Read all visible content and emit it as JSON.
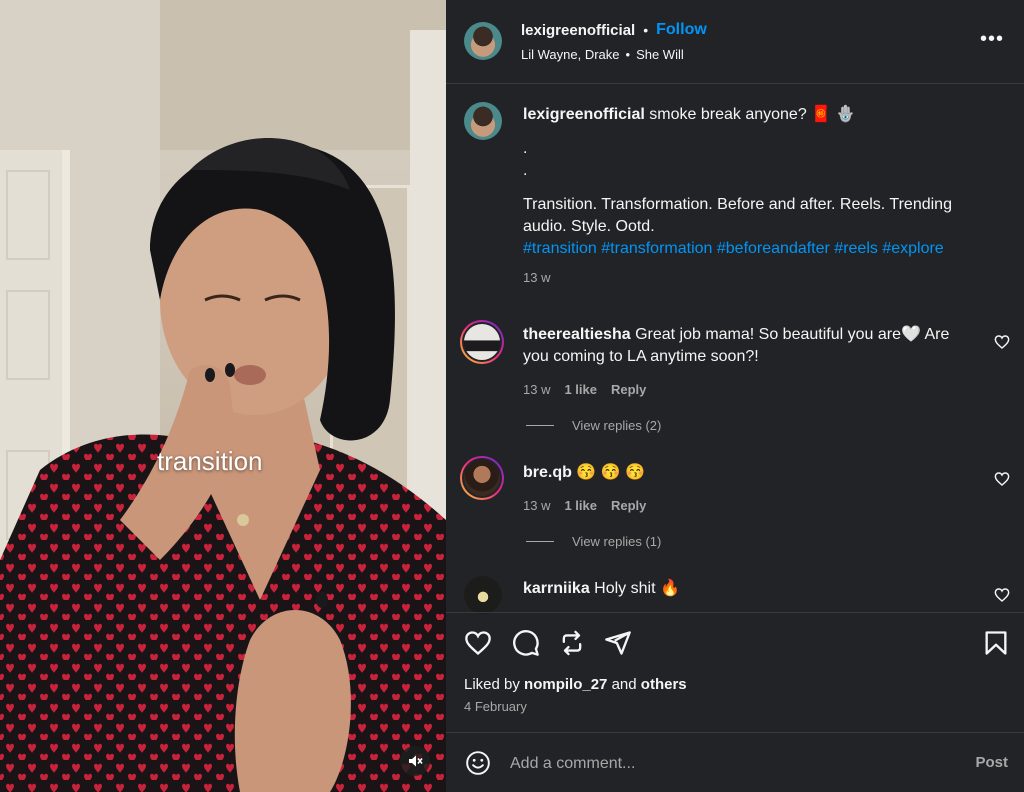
{
  "video": {
    "overlay_text": "transition",
    "mute_icon": "speaker-muted-icon"
  },
  "header": {
    "username": "lexigreenofficial",
    "separator": "•",
    "follow_label": "Follow",
    "audio_artists": "Lil Wayne, Drake",
    "audio_sep": "•",
    "audio_title": "She Will",
    "more_label": "•••"
  },
  "caption": {
    "username": "lexigreenofficial",
    "text": "smoke break anyone? 🧧 🪬",
    "dot1": ".",
    "dot2": ".",
    "body": "Transition. Transformation. Before and after. Reels. Trending audio. Style. Ootd.",
    "hashtags": "#transition #transformation #beforeandafter #reels #explore",
    "time": "13 w"
  },
  "comments": [
    {
      "username": "theerealtiesha",
      "text": "Great job mama! So beautiful you are🤍 Are you coming to LA anytime soon?!",
      "time": "13 w",
      "likes": "1 like",
      "reply": "Reply",
      "view_replies": "View replies (2)"
    },
    {
      "username": "bre.qb",
      "text": "😚 😚 😚",
      "time": "13 w",
      "likes": "1 like",
      "reply": "Reply",
      "view_replies": "View replies (1)"
    },
    {
      "username": "karrniika",
      "text": "Holy shit 🔥"
    }
  ],
  "actions": {
    "liked_by_prefix": "Liked by",
    "liked_by_user": "nompilo_27",
    "liked_by_and": "and",
    "liked_by_others": "others",
    "date": "4 February"
  },
  "comment_box": {
    "placeholder": "Add a comment...",
    "post_label": "Post"
  },
  "colors": {
    "panel_bg": "#222326",
    "link_blue": "#0095f6",
    "muted_text": "#a8a8a8"
  }
}
